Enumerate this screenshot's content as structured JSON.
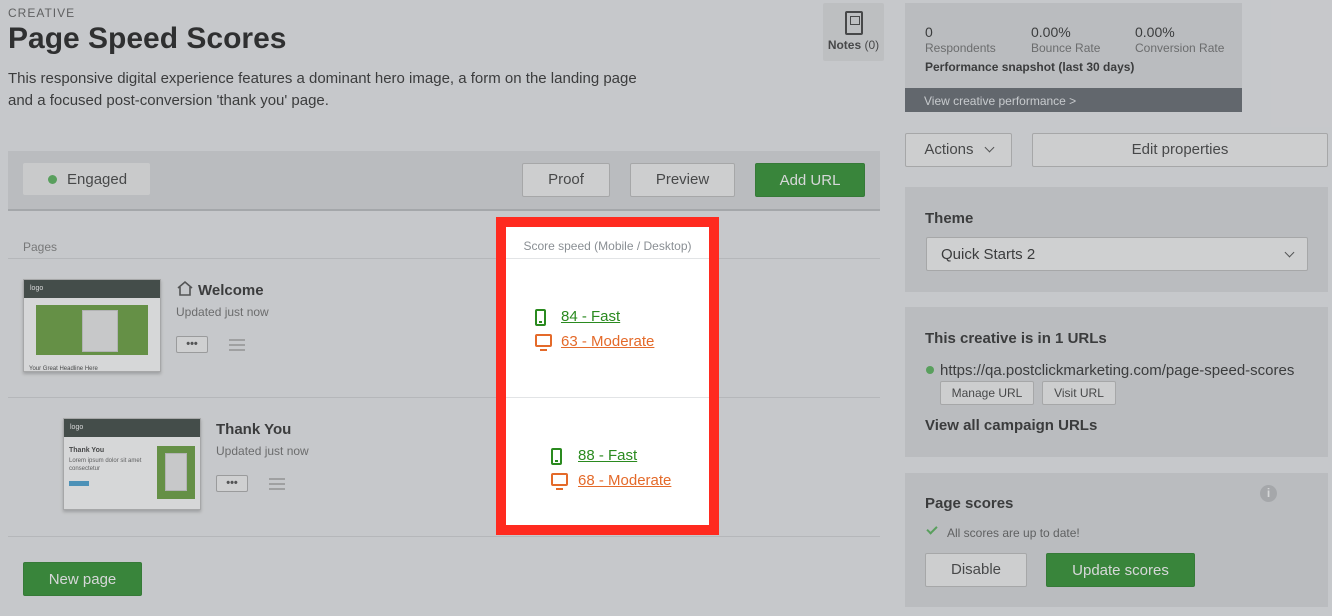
{
  "header": {
    "eyebrow": "CREATIVE",
    "title": "Page Speed Scores",
    "description_line1": "This responsive digital experience features a dominant hero image, a form on the landing page",
    "description_line2": "and a focused post-conversion 'thank you' page.",
    "notes_label": "Notes",
    "notes_count": "(0)"
  },
  "toolbar": {
    "status": "Engaged",
    "proof": "Proof",
    "preview": "Preview",
    "add_url": "Add URL"
  },
  "pages": {
    "header": "Pages",
    "score_header": "Score speed (Mobile / Desktop)",
    "items": [
      {
        "name": "Welcome",
        "updated": "Updated just now",
        "mobile_score": "84 - Fast",
        "desktop_score": "63 - Moderate"
      },
      {
        "name": "Thank You",
        "updated": "Updated just now",
        "mobile_score": "88 - Fast",
        "desktop_score": "68 - Moderate"
      }
    ],
    "more": "•••",
    "new_page": "New page",
    "thumb_logo": "logo",
    "thumb1_caption": "Your Great Headline Here",
    "thumb2_title": "Thank You",
    "thumb2_text": "Lorem ipsum dolor sit amet consectetur"
  },
  "stats": {
    "respondents_value": "0",
    "respondents_label": "Respondents",
    "bounce_value": "0.00%",
    "bounce_label": "Bounce Rate",
    "conversion_value": "0.00%",
    "conversion_label": "Conversion Rate",
    "snapshot": "Performance snapshot (last 30 days)",
    "view_performance": "View creative performance >"
  },
  "sidebar": {
    "actions": "Actions",
    "edit_properties": "Edit properties",
    "theme_title": "Theme",
    "theme_value": "Quick Starts 2",
    "urls_title": "This creative is in 1 URLs",
    "url": "https://qa.postclickmarketing.com/page-speed-scores",
    "manage_url": "Manage URL",
    "visit_url": "Visit URL",
    "view_all": "View all campaign URLs",
    "scores_title": "Page scores",
    "scores_status": "All scores are up to date!",
    "info_glyph": "i",
    "disable": "Disable",
    "update_scores": "Update scores"
  },
  "colors": {
    "green": "#1f8a1f",
    "highlight": "#ff2a1f",
    "fast": "#2a8a1f",
    "moderate": "#e46a2a"
  }
}
